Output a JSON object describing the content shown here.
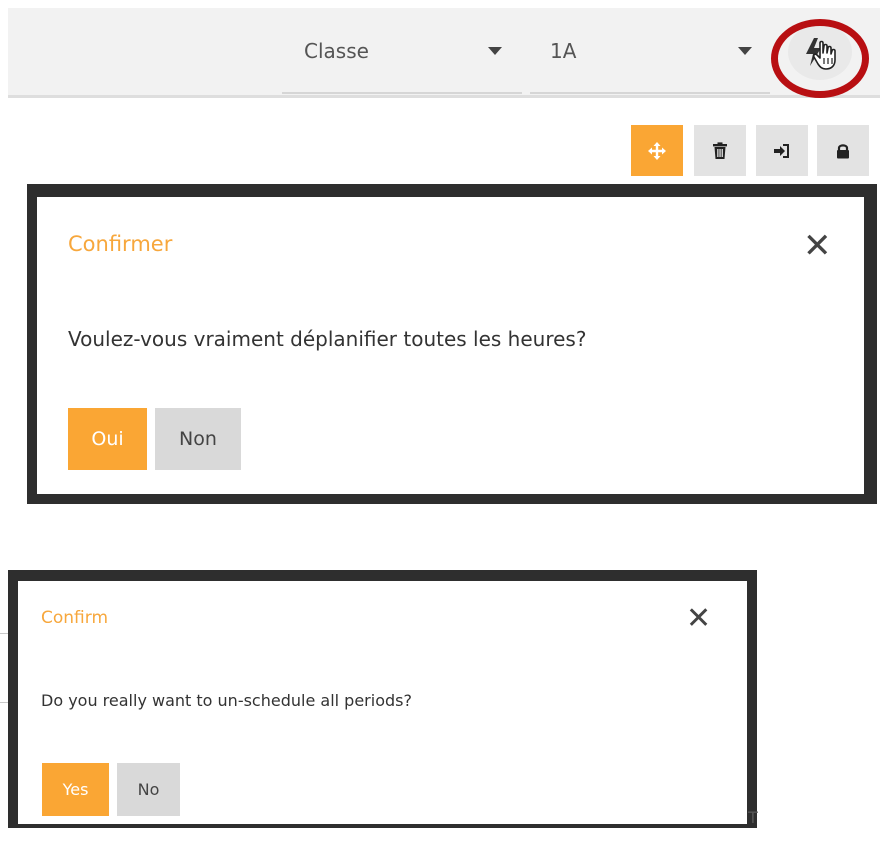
{
  "toolbar": {
    "class_dropdown": {
      "value": "Classe"
    },
    "group_dropdown": {
      "value": "1A"
    },
    "unplan_button": {
      "icon": "lightning-icon",
      "cursor": "hand-pointer-icon"
    },
    "highlight_color": "#b80f12"
  },
  "actions": [
    {
      "icon": "move-arrows-icon",
      "active": true
    },
    {
      "icon": "trash-icon",
      "active": false
    },
    {
      "icon": "sign-in-icon",
      "active": false
    },
    {
      "icon": "lock-icon",
      "active": false
    }
  ],
  "dialog_fr": {
    "title": "Confirmer",
    "close": "✕",
    "message": "Voulez-vous vraiment déplanifier toutes les heures?",
    "yes_label": "Oui",
    "no_label": "Non"
  },
  "dialog_en": {
    "title": "Confirm",
    "close": "✕",
    "message": "Do you really want to un-schedule all periods?",
    "yes_label": "Yes",
    "no_label": "No"
  },
  "background_text": "T",
  "colors": {
    "accent": "#faa634",
    "title": "#f7a73c",
    "secondary_button": "#d9d9d9",
    "dialog_border": "#2e2e2e"
  }
}
